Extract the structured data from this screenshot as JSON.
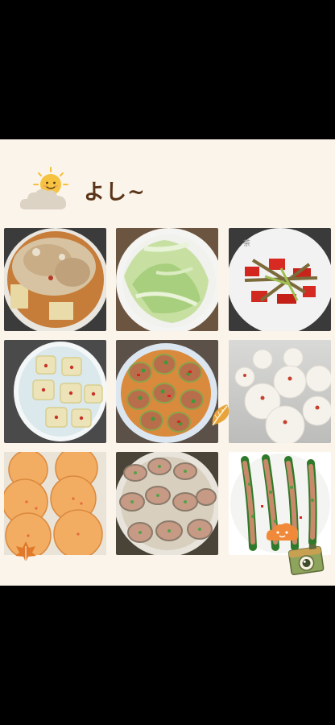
{
  "canvas": {
    "background": "#fbf4ea"
  },
  "header": {
    "title": "よし~",
    "sun_icon": "sun-icon",
    "cloud_icon": "cloud-icon"
  },
  "photos": [
    {
      "row": 1,
      "col": 1,
      "dish": "steamed-fish-egg"
    },
    {
      "row": 1,
      "col": 2,
      "dish": "stir-fried-cabbage"
    },
    {
      "row": 1,
      "col": 3,
      "dish": "stir-fried-peppers"
    },
    {
      "row": 2,
      "col": 1,
      "dish": "cabbage-rolls"
    },
    {
      "row": 2,
      "col": 2,
      "dish": "stuffed-peppers"
    },
    {
      "row": 2,
      "col": 3,
      "dish": "steamed-buns"
    },
    {
      "row": 3,
      "col": 1,
      "dish": "fried-pancakes"
    },
    {
      "row": 3,
      "col": 2,
      "dish": "garlic-scallops"
    },
    {
      "row": 3,
      "col": 3,
      "dish": "stuffed-okra"
    }
  ],
  "stickers": {
    "leaf_icon": "leaf-icon",
    "cloud_face_icon": "cloud-face-icon",
    "camera_icon": "camera-icon"
  },
  "colors": {
    "title": "#5a3418",
    "leaf": "#e8a43a",
    "sun": "#f5c03b"
  }
}
